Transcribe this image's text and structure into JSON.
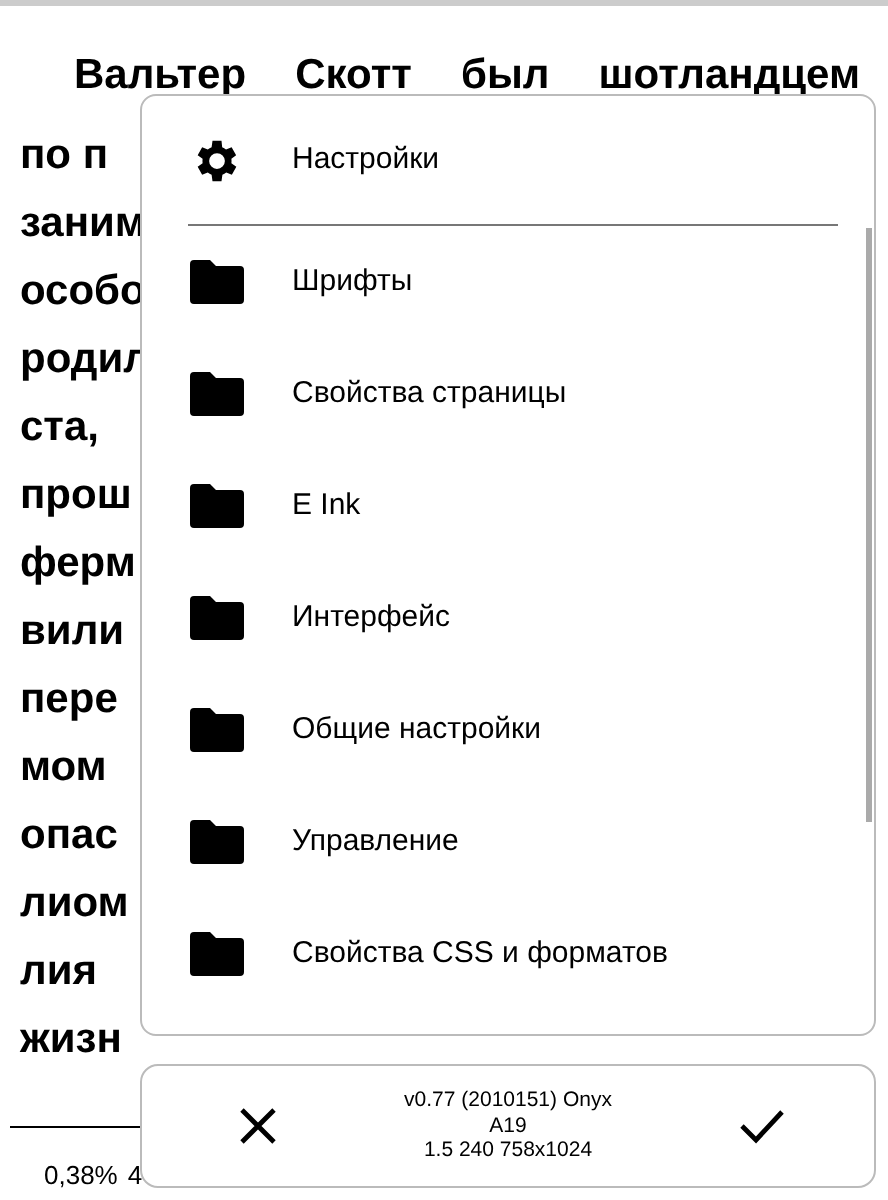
{
  "reader": {
    "lines": [
      "Вальтер Скотт был шотландцем",
      "по п",
      "заним",
      "особо",
      "родил",
      "ста,",
      "прош",
      "ферм",
      "вили",
      "пере",
      "мом",
      "опас",
      "лиом",
      "лия",
      "жизн"
    ],
    "progress": {
      "percent": "0,38%",
      "page": "4"
    }
  },
  "menu": {
    "header": {
      "label": "Настройки"
    },
    "items": [
      {
        "label": "Шрифты"
      },
      {
        "label": "Свойства страницы"
      },
      {
        "label": "E Ink"
      },
      {
        "label": "Интерфейс"
      },
      {
        "label": "Общие настройки"
      },
      {
        "label": "Управление"
      },
      {
        "label": "Свойства CSS и форматов"
      }
    ]
  },
  "bottom_panel": {
    "version_lines": [
      "v0.77 (2010151) Onyx",
      "A19",
      "1.5 240 758x1024"
    ]
  }
}
